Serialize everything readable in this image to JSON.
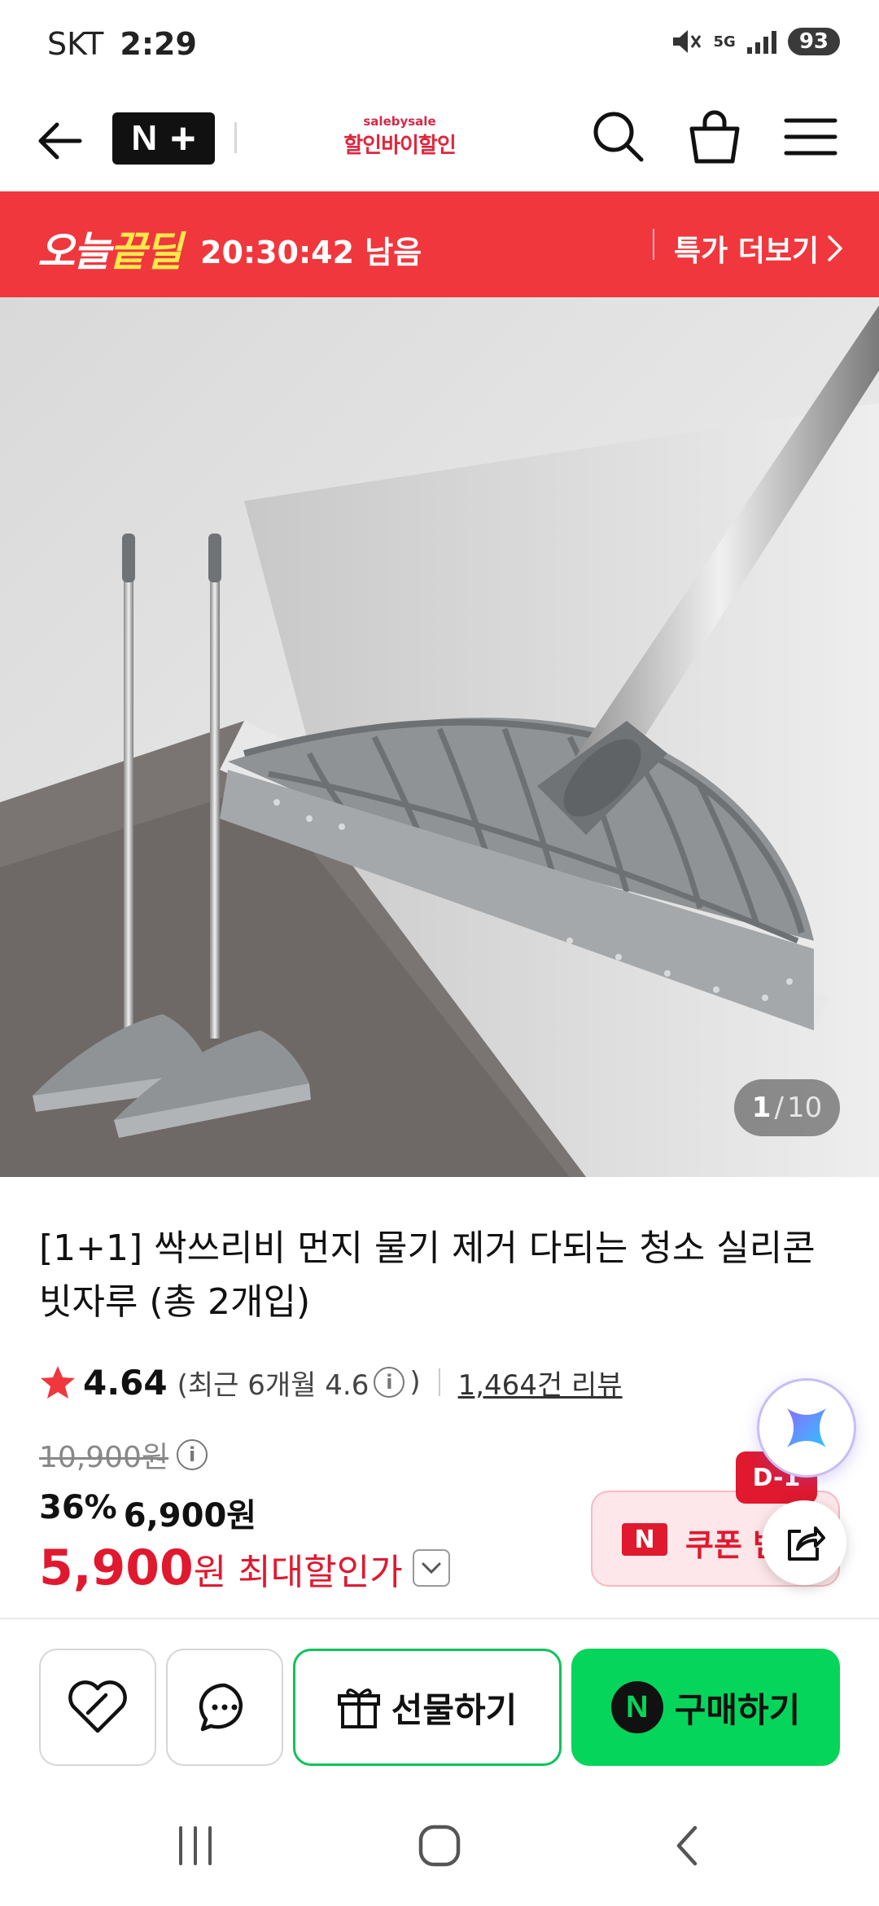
{
  "status_bar": {
    "carrier": "SKT",
    "time": "2:29",
    "network": "5G",
    "battery": "93"
  },
  "header": {
    "brand_sub": "salebysale",
    "brand_main": "할인바이할인",
    "nplus_logo": "N"
  },
  "deal_banner": {
    "logo_part1": "오늘",
    "logo_part2": "끝딜",
    "timer": "20:30:42 남음",
    "more_label": "특가 더보기"
  },
  "gallery": {
    "current": "1",
    "separator": "/",
    "total": "10"
  },
  "product": {
    "title": "[1+1] 싹쓰리비 먼지 물기 제거 다되는 청소 실리콘 빗자루 (총 2개입)",
    "rating": "4.64",
    "recent_rating": "(최근 6개월 4.6",
    "recent_rating_close": ")",
    "review_count": "1,464건 리뷰",
    "original_price": "10,900원",
    "discount_rate": "36%",
    "sale_price": "6,900원",
    "max_price": "5,900",
    "max_price_unit": "원",
    "max_label": "최대할인가"
  },
  "coupon": {
    "n_label": "N",
    "label": "쿠폰 받기",
    "dday": "D-1"
  },
  "actions": {
    "gift_label": "선물하기",
    "buy_n": "N",
    "buy_label": "구매하기"
  },
  "colors": {
    "deal_red": "#f0373d",
    "price_red": "#e0192f",
    "naver_green": "#05d55b"
  }
}
